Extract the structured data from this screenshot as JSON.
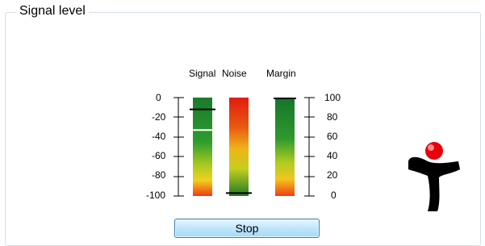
{
  "group": {
    "title": "Signal level"
  },
  "meters": {
    "columns": {
      "signal": "Signal",
      "noise": "Noise",
      "margin": "Margin"
    },
    "left_ticks": [
      "0",
      "-20",
      "-40",
      "-60",
      "-80",
      "-100"
    ],
    "right_ticks": [
      "100",
      "80",
      "60",
      "40",
      "20",
      "0"
    ],
    "signal_dbm": -12,
    "signal_peak_dbm": -33,
    "noise_dbm": -97,
    "margin_percent": 100
  },
  "controls": {
    "stop_label": "Stop"
  },
  "logo": {
    "icon": "t-logo-icon",
    "dot_color": "#e8000b",
    "body_color": "#000000"
  }
}
